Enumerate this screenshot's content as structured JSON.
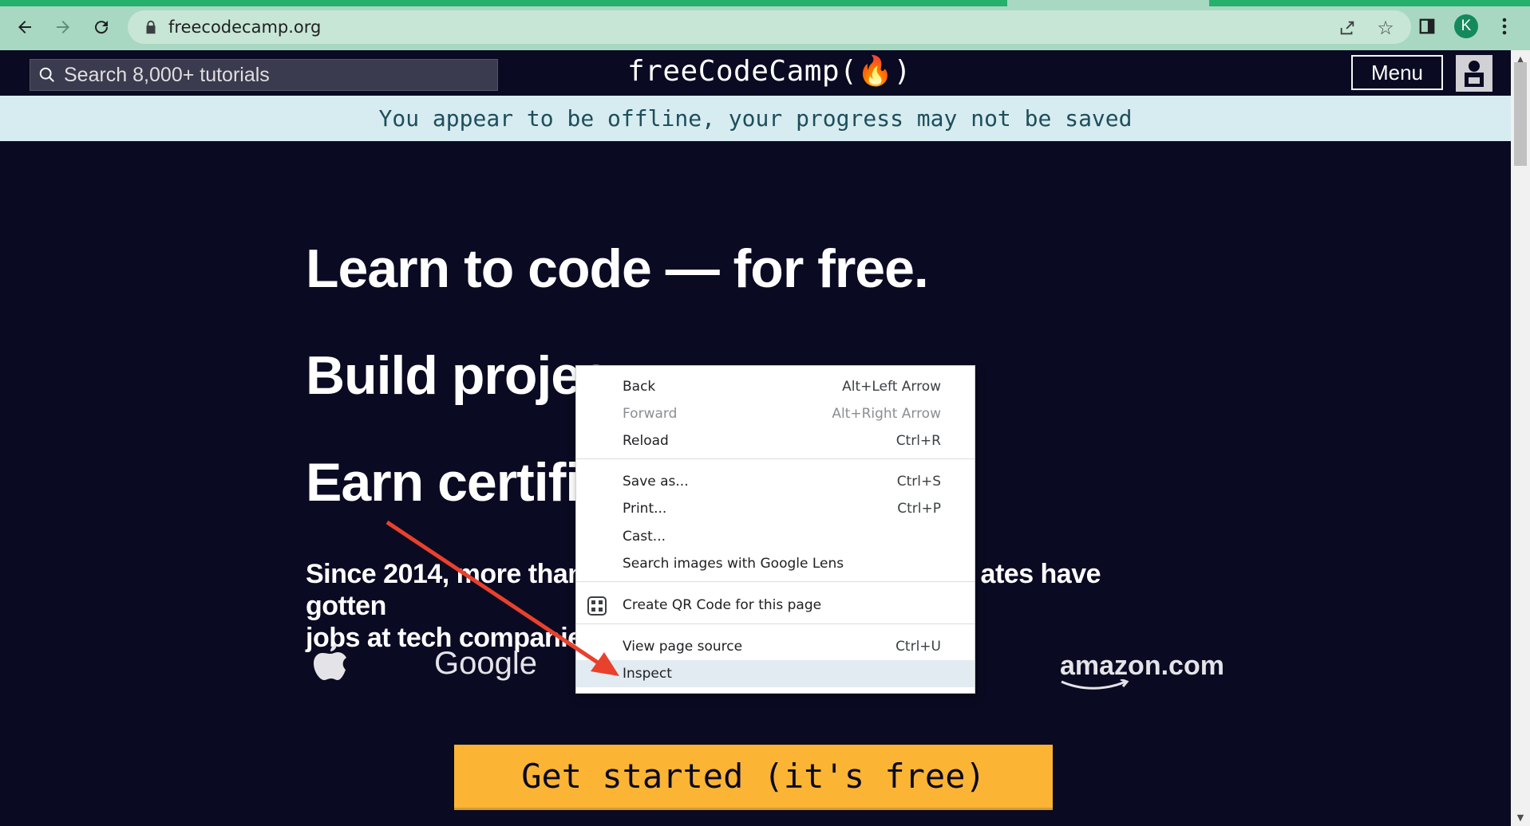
{
  "browser": {
    "url": "freecodecamp.org",
    "profile_initial": "K",
    "icons": {
      "back": "back-arrow-icon",
      "forward": "forward-arrow-icon",
      "reload": "reload-icon",
      "lock": "lock-icon",
      "share": "share-icon",
      "bookmark": "star-icon",
      "sidepanel": "side-panel-icon",
      "more": "more-vert-icon"
    }
  },
  "nav": {
    "search_placeholder": "Search 8,000+ tutorials",
    "brand": "freeCodeCamp(🔥)",
    "menu_label": "Menu"
  },
  "banner": {
    "offline_text": "You appear to be offline, your progress may not be saved"
  },
  "hero": {
    "line1": "Learn to code — for free.",
    "line2": "Build projec",
    "line3": "Earn certific",
    "since_line1_left": "Since 2014, more than",
    "since_line1_right": "ates have gotten",
    "since_line2": "jobs at tech companies",
    "logos": [
      "apple-logo",
      "Google",
      "amazon.com"
    ],
    "cta_label": "Get started (it's free)"
  },
  "context_menu": {
    "items": [
      {
        "label": "Back",
        "shortcut": "Alt+Left Arrow",
        "disabled": false
      },
      {
        "label": "Forward",
        "shortcut": "Alt+Right Arrow",
        "disabled": true
      },
      {
        "label": "Reload",
        "shortcut": "Ctrl+R",
        "disabled": false
      },
      {
        "label": "Save as...",
        "shortcut": "Ctrl+S",
        "disabled": false
      },
      {
        "label": "Print...",
        "shortcut": "Ctrl+P",
        "disabled": false
      },
      {
        "label": "Cast...",
        "shortcut": "",
        "disabled": false
      },
      {
        "label": "Search images with Google Lens",
        "shortcut": "",
        "disabled": false
      },
      {
        "label": "Create QR Code for this page",
        "shortcut": "",
        "disabled": false,
        "icon": "qr-code-icon"
      },
      {
        "label": "View page source",
        "shortcut": "Ctrl+U",
        "disabled": false
      },
      {
        "label": "Inspect",
        "shortcut": "",
        "disabled": false,
        "highlighted": true
      }
    ]
  },
  "annotation": {
    "arrow_color": "#e8412c"
  },
  "colors": {
    "page_bg": "#0a0a23",
    "cta": "#fcb434",
    "offline_banner": "#d7ecf0",
    "chrome_toolbar": "#a9d8c2"
  }
}
